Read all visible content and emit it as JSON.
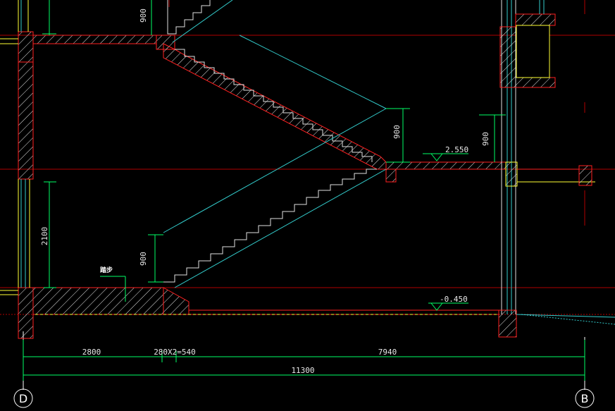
{
  "drawing": {
    "type": "stair-section",
    "colors": {
      "background": "#000000",
      "wall_outline": "#ff2020",
      "hatch": "#e6e6e6",
      "window": "#ffff33",
      "dimension": "#00ff66",
      "grid": "#b00000",
      "sightline": "#33cccc",
      "step_line": "#e0e0e0"
    },
    "dimensions": {
      "top_riser": "900",
      "mid_riser": "900",
      "right_riser": "900",
      "bottom_riser": "900",
      "wall_height": "2100",
      "span_left": "2800",
      "span_steps": "280X2=540",
      "span_right": "7940",
      "span_total": "11300"
    },
    "levels": {
      "landing": "2.550",
      "ground": "-0.450"
    },
    "note": "踏步",
    "axes": {
      "left": "D",
      "right": "B"
    }
  }
}
